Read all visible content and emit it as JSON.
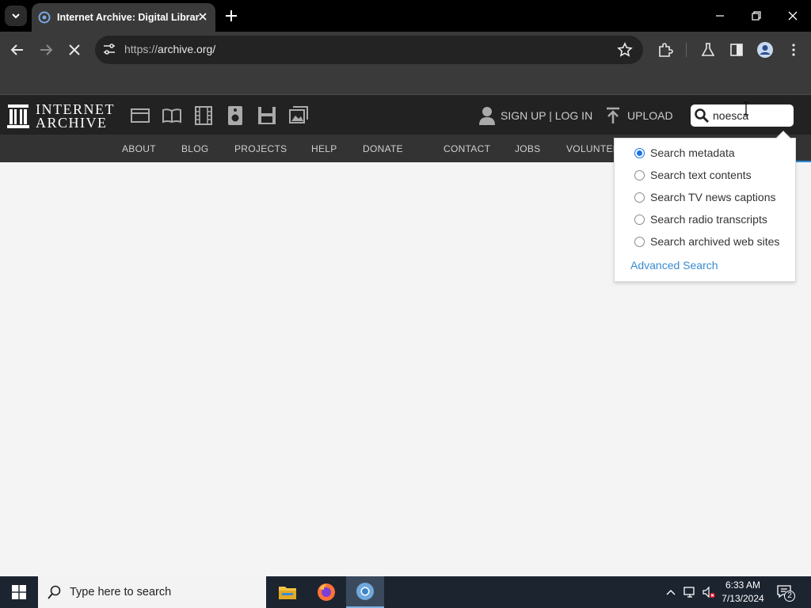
{
  "browser": {
    "tab_title": "Internet Archive: Digital Library",
    "url_scheme": "https://",
    "url_host": "archive.org/"
  },
  "ia_header": {
    "logo_line1": "INTERNET",
    "logo_line2": "ARCHIVE",
    "signup_login": "SIGN UP | LOG IN",
    "upload": "UPLOAD",
    "search_value": "noesca"
  },
  "subnav": {
    "items": [
      "ABOUT",
      "BLOG",
      "PROJECTS",
      "HELP",
      "DONATE",
      "CONTACT",
      "JOBS",
      "VOLUNTEER"
    ]
  },
  "search_options": {
    "options": [
      {
        "label": "Search metadata",
        "selected": true
      },
      {
        "label": "Search text contents",
        "selected": false
      },
      {
        "label": "Search TV news captions",
        "selected": false
      },
      {
        "label": "Search radio transcripts",
        "selected": false
      },
      {
        "label": "Search archived web sites",
        "selected": false
      }
    ],
    "advanced_link": "Advanced Search"
  },
  "taskbar": {
    "search_placeholder": "Type here to search",
    "time": "6:33 AM",
    "date": "7/13/2024",
    "notification_count": "2"
  },
  "colors": {
    "accent_blue": "#1a73e8",
    "link_blue": "#3a8bd2",
    "donate_heart": "#e8151b"
  }
}
